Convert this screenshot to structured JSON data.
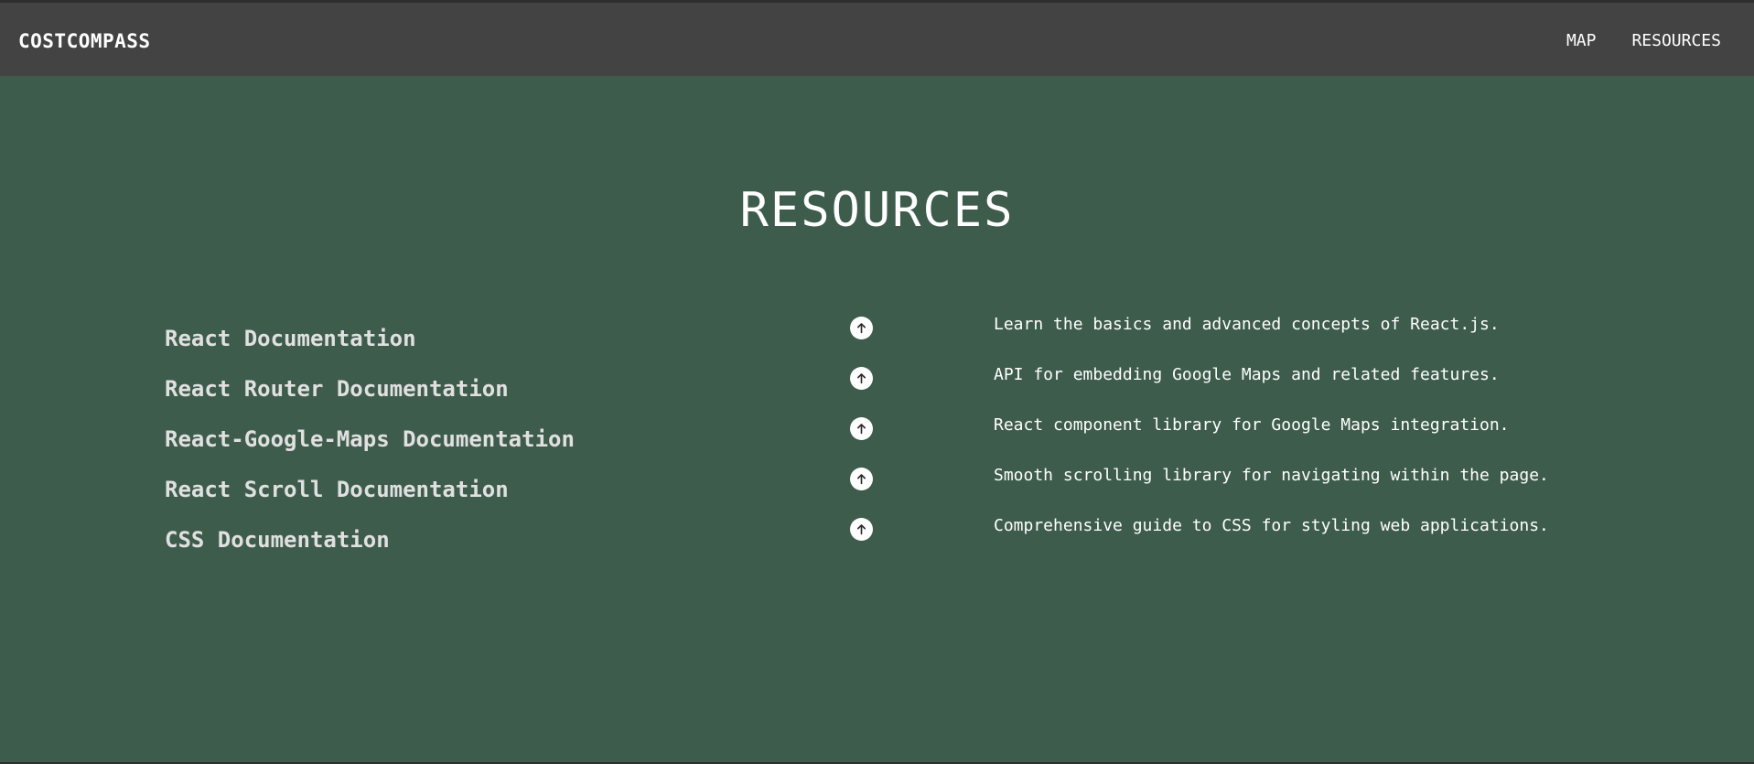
{
  "navbar": {
    "brand": "COSTCOMPASS",
    "links": [
      {
        "label": "MAP"
      },
      {
        "label": "RESOURCES"
      }
    ]
  },
  "page": {
    "title": "RESOURCES"
  },
  "resources": [
    {
      "title": "React Documentation",
      "description": "Learn the basics and advanced concepts of React.js.",
      "icon": "arrow-up-icon"
    },
    {
      "title": "React Router Documentation",
      "description": "API for embedding Google Maps and related features.",
      "icon": "arrow-up-icon"
    },
    {
      "title": "React-Google-Maps Documentation",
      "description": "React component library for Google Maps integration.",
      "icon": "arrow-up-icon"
    },
    {
      "title": "React Scroll Documentation",
      "description": "Smooth scrolling library for navigating within the page.",
      "icon": "arrow-up-icon"
    },
    {
      "title": "CSS Documentation",
      "description": "Comprehensive guide to CSS for styling web applications.",
      "icon": "arrow-up-icon"
    }
  ],
  "colors": {
    "background": "#3d5c4c",
    "navbar": "#434343",
    "text": "#ffffff"
  }
}
